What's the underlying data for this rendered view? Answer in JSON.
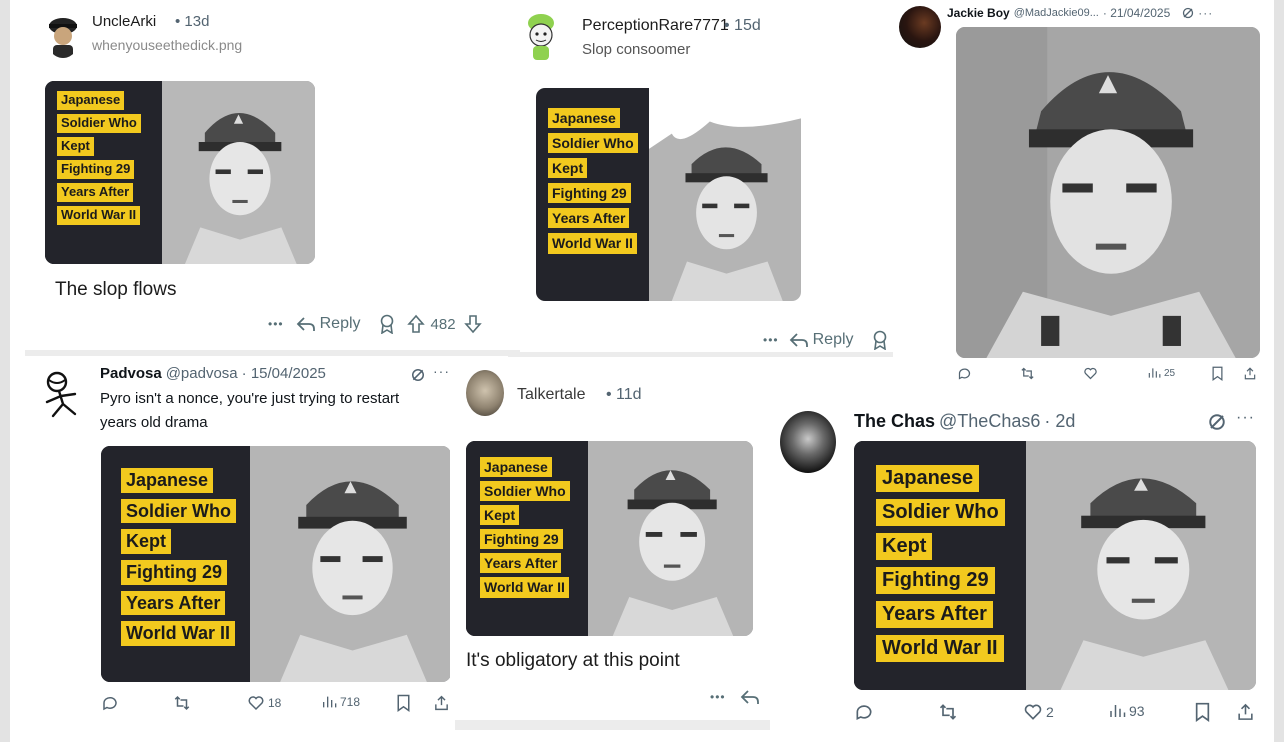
{
  "posts": [
    {
      "id": "uncle",
      "username": "UncleArki",
      "time": "• 13d",
      "subtitle": "whenyouseethedick.png",
      "caption": "The slop flows",
      "actions": {
        "more": "•••",
        "reply": "Reply",
        "score": "482"
      }
    },
    {
      "id": "perception",
      "username": "PerceptionRare7771",
      "time": "• 15d",
      "subtitle": "Slop consoomer",
      "actions": {
        "more": "•••",
        "reply": "Reply"
      }
    },
    {
      "id": "jackie",
      "display_name": "Jackie Boy",
      "handle": "@MadJackie09...",
      "time": "· 21/04/2025",
      "actions": {
        "views": "25"
      }
    },
    {
      "id": "padvosa",
      "display_name": "Padvosa",
      "handle": "@padvosa",
      "time": "· 15/04/2025",
      "text_line1": "Pyro isn't a nonce, you're just trying to restart",
      "text_line2": "years old drama",
      "actions": {
        "likes": "18",
        "views": "718"
      }
    },
    {
      "id": "talker",
      "username": "Talkertale",
      "time": "• 11d",
      "caption": "It's obligatory at this point",
      "actions": {
        "more": "•••"
      }
    },
    {
      "id": "chas",
      "display_name": "The Chas",
      "handle": "@TheChas6",
      "time": "· 2d",
      "actions": {
        "likes": "2",
        "views": "93"
      }
    }
  ],
  "meme_lines": [
    "Japanese",
    "Soldier Who",
    "Kept",
    "Fighting 29",
    "Years After",
    "World War II"
  ],
  "colors": {
    "label_bg": "#f2c91e",
    "dark_panel": "#23242b",
    "muted": "#536471"
  },
  "icons": [
    "more-icon",
    "reply-icon",
    "award-icon",
    "upvote-icon",
    "downvote-icon",
    "comment-icon",
    "retweet-icon",
    "heart-icon",
    "views-icon",
    "bookmark-icon",
    "share-icon",
    "grok-icon"
  ]
}
